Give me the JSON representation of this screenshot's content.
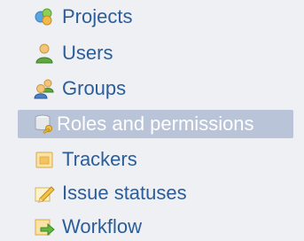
{
  "menu": {
    "items": [
      {
        "label": "Projects",
        "icon": "projects-icon",
        "selected": false
      },
      {
        "label": "Users",
        "icon": "user-icon",
        "selected": false
      },
      {
        "label": "Groups",
        "icon": "group-icon",
        "selected": false
      },
      {
        "label": "Roles and permissions",
        "icon": "database-key-icon",
        "selected": true
      },
      {
        "label": "Trackers",
        "icon": "ticket-icon",
        "selected": false
      },
      {
        "label": "Issue statuses",
        "icon": "pencil-note-icon",
        "selected": false
      },
      {
        "label": "Workflow",
        "icon": "arrow-right-icon",
        "selected": false
      }
    ]
  },
  "colors": {
    "background": "#eef0f3",
    "link": "#2b5d9a",
    "selected_bg": "#b9c4d9",
    "selected_text": "#ffffff"
  }
}
